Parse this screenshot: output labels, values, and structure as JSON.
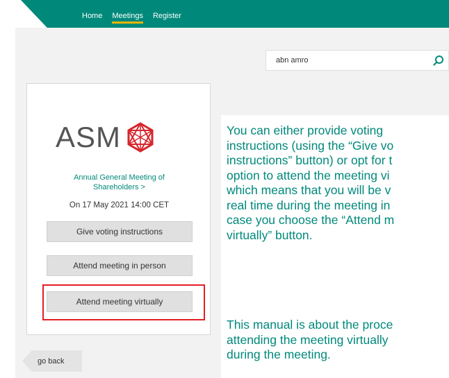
{
  "nav": {
    "items": [
      "Home",
      "Meetings",
      "Register"
    ]
  },
  "search": {
    "value": "abn amro"
  },
  "card": {
    "logo_text": "ASM",
    "meeting_title_lines": [
      "Annual General Meeting of",
      "Shareholders >"
    ],
    "date": "On 17 May 2021 14:00 CET",
    "buttons": [
      "Give voting instructions",
      "Attend meeting in person",
      "Attend meeting virtually"
    ]
  },
  "go_back": "go back",
  "explanation": {
    "paragraph1_lines": [
      "You can either provide voting",
      "instructions (using the “Give vo",
      "instructions” button) or opt for t",
      "option to attend the meeting vi",
      "which means that you will be v",
      "real time during the meeting in",
      "case you choose the “Attend m",
      "virtually” button."
    ],
    "paragraph2_lines": [
      "This manual is about the proce",
      "attending the meeting virtually",
      "during the meeting."
    ]
  },
  "colors": {
    "brand": "#00897b",
    "accent": "#f5b400",
    "highlight": "#e31e24",
    "logo_red": "#d7262d"
  }
}
